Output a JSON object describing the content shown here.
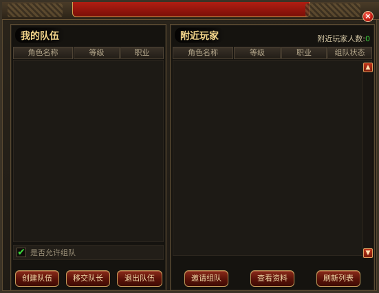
{
  "close_label": "×",
  "my_team": {
    "title": "我的队伍",
    "columns": [
      "角色名称",
      "等级",
      "职业"
    ],
    "allow_label": "是否允许组队",
    "allow_checked": "✔",
    "buttons": [
      "创建队伍",
      "移交队长",
      "退出队伍"
    ]
  },
  "nearby": {
    "title": "附近玩家",
    "count_label": "附近玩家人数:",
    "count_value": "0",
    "columns": [
      "角色名称",
      "等级",
      "职业",
      "组队状态"
    ],
    "scroll_up": "▲",
    "scroll_down": "▼",
    "buttons": [
      "邀请组队",
      "查看资料",
      "刷新列表"
    ]
  },
  "colors": {
    "accent": "#b01e12",
    "title_text": "#f2d48a",
    "count_green": "#3fd13f"
  }
}
